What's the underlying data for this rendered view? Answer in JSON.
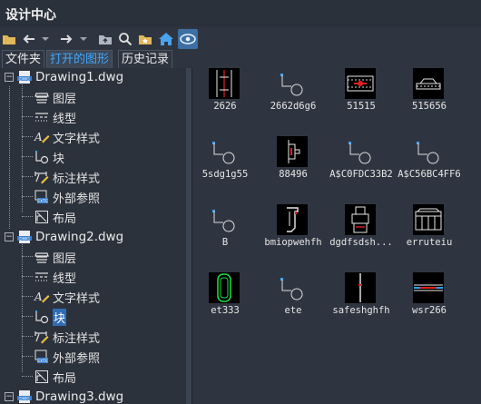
{
  "window": {
    "title": "设计中心"
  },
  "tabs": [
    {
      "label": "文件夹"
    },
    {
      "label": "打开的图形"
    },
    {
      "label": "历史记录"
    }
  ],
  "toolbar": {
    "icons": [
      "folder-icon",
      "back-arrow-icon",
      "forward-arrow-icon",
      "up-folder-icon",
      "search-icon",
      "favorites-icon",
      "home-icon",
      "preview-toggle-icon"
    ]
  },
  "tree": {
    "drawings": [
      {
        "name": "Drawing1.dwg",
        "children": [
          "图层",
          "线型",
          "文字样式",
          "块",
          "标注样式",
          "外部参照",
          "布局"
        ]
      },
      {
        "name": "Drawing2.dwg",
        "children": [
          "图层",
          "线型",
          "文字样式",
          "块",
          "标注样式",
          "外部参照",
          "布局"
        ],
        "selected": "块"
      },
      {
        "name": "Drawing3.dwg",
        "children": []
      }
    ]
  },
  "blocks": [
    {
      "name": "2626"
    },
    {
      "name": "2662d6g6"
    },
    {
      "name": "51515"
    },
    {
      "name": "515656"
    },
    {
      "name": "5sdg1g55"
    },
    {
      "name": "88496"
    },
    {
      "name": "A$C0FDC33B2"
    },
    {
      "name": "A$C56BC4FF6"
    },
    {
      "name": "B"
    },
    {
      "name": "bmiopwehfh"
    },
    {
      "name": "dgdfsdsh..."
    },
    {
      "name": "erruteiu"
    },
    {
      "name": "et333"
    },
    {
      "name": "ete"
    },
    {
      "name": "safeshghfh"
    },
    {
      "name": "wsr266"
    }
  ],
  "colors": {
    "accent": "#3fa8ff",
    "selection": "#2e6db4",
    "background": "#2f3540"
  }
}
